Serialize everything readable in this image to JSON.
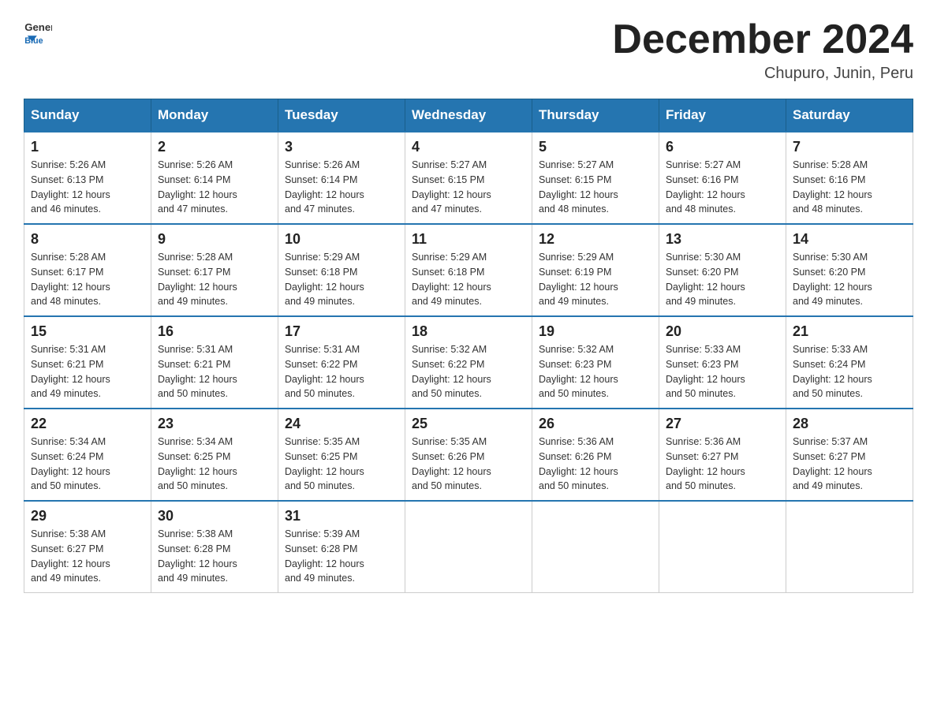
{
  "header": {
    "logo_general": "General",
    "logo_blue": "Blue",
    "month_year": "December 2024",
    "location": "Chupuro, Junin, Peru"
  },
  "weekdays": [
    "Sunday",
    "Monday",
    "Tuesday",
    "Wednesday",
    "Thursday",
    "Friday",
    "Saturday"
  ],
  "weeks": [
    [
      {
        "day": "1",
        "sunrise": "5:26 AM",
        "sunset": "6:13 PM",
        "daylight": "12 hours and 46 minutes."
      },
      {
        "day": "2",
        "sunrise": "5:26 AM",
        "sunset": "6:14 PM",
        "daylight": "12 hours and 47 minutes."
      },
      {
        "day": "3",
        "sunrise": "5:26 AM",
        "sunset": "6:14 PM",
        "daylight": "12 hours and 47 minutes."
      },
      {
        "day": "4",
        "sunrise": "5:27 AM",
        "sunset": "6:15 PM",
        "daylight": "12 hours and 47 minutes."
      },
      {
        "day": "5",
        "sunrise": "5:27 AM",
        "sunset": "6:15 PM",
        "daylight": "12 hours and 48 minutes."
      },
      {
        "day": "6",
        "sunrise": "5:27 AM",
        "sunset": "6:16 PM",
        "daylight": "12 hours and 48 minutes."
      },
      {
        "day": "7",
        "sunrise": "5:28 AM",
        "sunset": "6:16 PM",
        "daylight": "12 hours and 48 minutes."
      }
    ],
    [
      {
        "day": "8",
        "sunrise": "5:28 AM",
        "sunset": "6:17 PM",
        "daylight": "12 hours and 48 minutes."
      },
      {
        "day": "9",
        "sunrise": "5:28 AM",
        "sunset": "6:17 PM",
        "daylight": "12 hours and 49 minutes."
      },
      {
        "day": "10",
        "sunrise": "5:29 AM",
        "sunset": "6:18 PM",
        "daylight": "12 hours and 49 minutes."
      },
      {
        "day": "11",
        "sunrise": "5:29 AM",
        "sunset": "6:18 PM",
        "daylight": "12 hours and 49 minutes."
      },
      {
        "day": "12",
        "sunrise": "5:29 AM",
        "sunset": "6:19 PM",
        "daylight": "12 hours and 49 minutes."
      },
      {
        "day": "13",
        "sunrise": "5:30 AM",
        "sunset": "6:20 PM",
        "daylight": "12 hours and 49 minutes."
      },
      {
        "day": "14",
        "sunrise": "5:30 AM",
        "sunset": "6:20 PM",
        "daylight": "12 hours and 49 minutes."
      }
    ],
    [
      {
        "day": "15",
        "sunrise": "5:31 AM",
        "sunset": "6:21 PM",
        "daylight": "12 hours and 49 minutes."
      },
      {
        "day": "16",
        "sunrise": "5:31 AM",
        "sunset": "6:21 PM",
        "daylight": "12 hours and 50 minutes."
      },
      {
        "day": "17",
        "sunrise": "5:31 AM",
        "sunset": "6:22 PM",
        "daylight": "12 hours and 50 minutes."
      },
      {
        "day": "18",
        "sunrise": "5:32 AM",
        "sunset": "6:22 PM",
        "daylight": "12 hours and 50 minutes."
      },
      {
        "day": "19",
        "sunrise": "5:32 AM",
        "sunset": "6:23 PM",
        "daylight": "12 hours and 50 minutes."
      },
      {
        "day": "20",
        "sunrise": "5:33 AM",
        "sunset": "6:23 PM",
        "daylight": "12 hours and 50 minutes."
      },
      {
        "day": "21",
        "sunrise": "5:33 AM",
        "sunset": "6:24 PM",
        "daylight": "12 hours and 50 minutes."
      }
    ],
    [
      {
        "day": "22",
        "sunrise": "5:34 AM",
        "sunset": "6:24 PM",
        "daylight": "12 hours and 50 minutes."
      },
      {
        "day": "23",
        "sunrise": "5:34 AM",
        "sunset": "6:25 PM",
        "daylight": "12 hours and 50 minutes."
      },
      {
        "day": "24",
        "sunrise": "5:35 AM",
        "sunset": "6:25 PM",
        "daylight": "12 hours and 50 minutes."
      },
      {
        "day": "25",
        "sunrise": "5:35 AM",
        "sunset": "6:26 PM",
        "daylight": "12 hours and 50 minutes."
      },
      {
        "day": "26",
        "sunrise": "5:36 AM",
        "sunset": "6:26 PM",
        "daylight": "12 hours and 50 minutes."
      },
      {
        "day": "27",
        "sunrise": "5:36 AM",
        "sunset": "6:27 PM",
        "daylight": "12 hours and 50 minutes."
      },
      {
        "day": "28",
        "sunrise": "5:37 AM",
        "sunset": "6:27 PM",
        "daylight": "12 hours and 49 minutes."
      }
    ],
    [
      {
        "day": "29",
        "sunrise": "5:38 AM",
        "sunset": "6:27 PM",
        "daylight": "12 hours and 49 minutes."
      },
      {
        "day": "30",
        "sunrise": "5:38 AM",
        "sunset": "6:28 PM",
        "daylight": "12 hours and 49 minutes."
      },
      {
        "day": "31",
        "sunrise": "5:39 AM",
        "sunset": "6:28 PM",
        "daylight": "12 hours and 49 minutes."
      },
      null,
      null,
      null,
      null
    ]
  ],
  "labels": {
    "sunrise": "Sunrise:",
    "sunset": "Sunset:",
    "daylight": "Daylight:"
  }
}
